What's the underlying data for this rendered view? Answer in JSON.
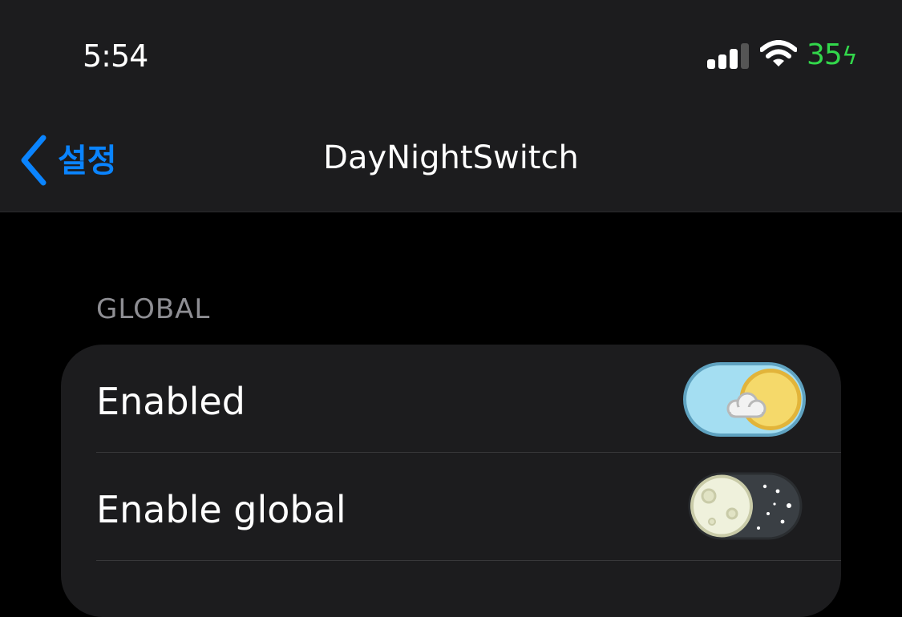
{
  "status_bar": {
    "time": "5:54",
    "battery_level": "35",
    "battery_glyph": "ϟ",
    "battery_color": "#32d74b",
    "signal_icon": "cellular-signal-icon",
    "wifi_icon": "wifi-icon"
  },
  "nav": {
    "back_label": "설정",
    "back_icon": "chevron-left-icon",
    "title": "DayNightSwitch",
    "accent": "#0a84ff"
  },
  "sections": [
    {
      "header": "GLOBAL",
      "rows": [
        {
          "label": "Enabled",
          "toggle": "day",
          "on": true
        },
        {
          "label": "Enable global",
          "toggle": "night",
          "on": false
        }
      ]
    }
  ]
}
